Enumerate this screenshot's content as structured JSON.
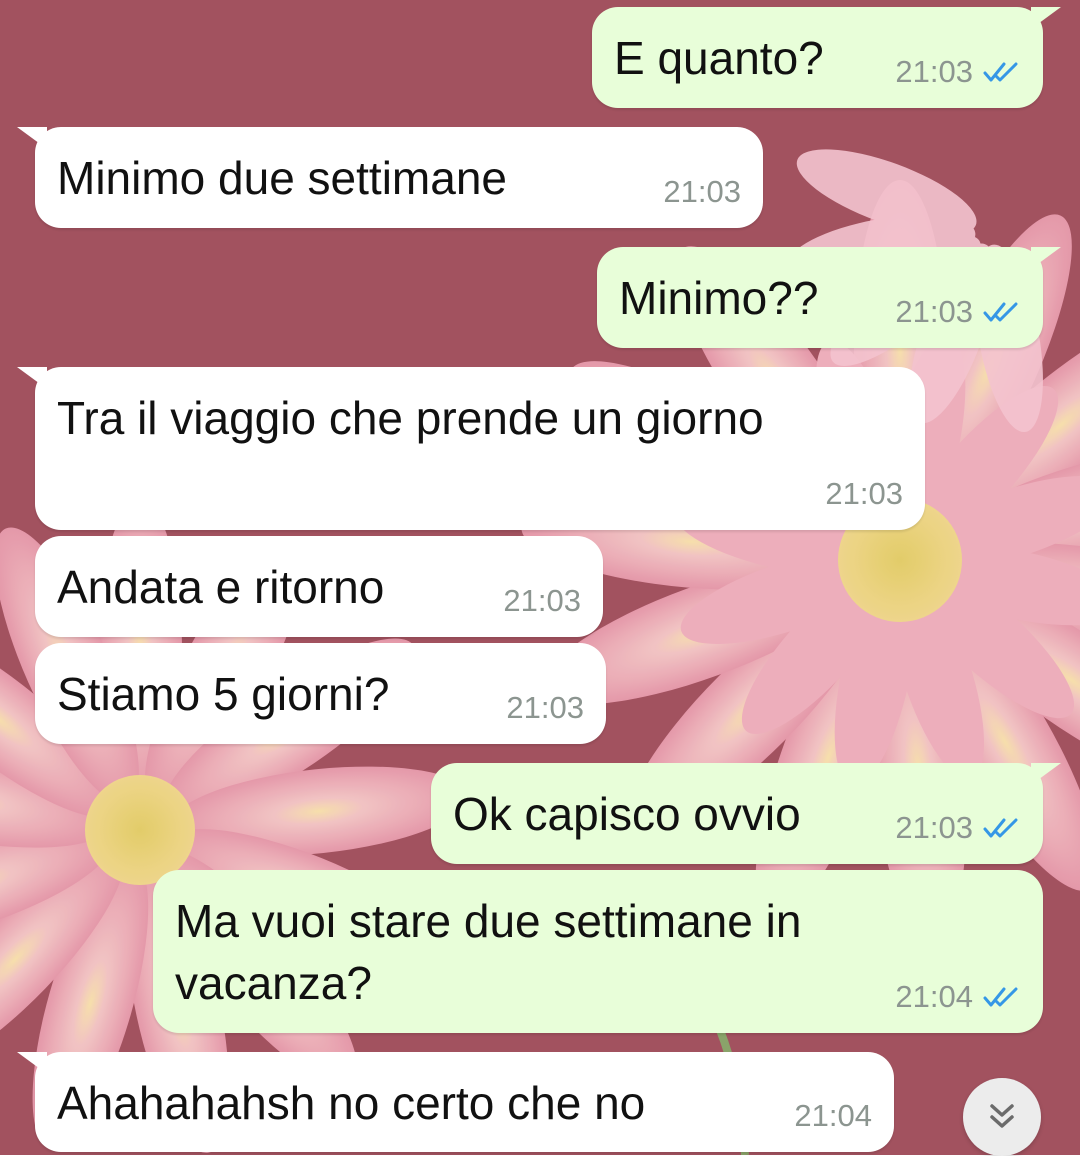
{
  "colors": {
    "wallpaper": "#a2525f",
    "incoming_bubble": "#ffffff",
    "outgoing_bubble": "#e8fed9",
    "read_ticks": "#3597e6",
    "timestamp": "#8c9590"
  },
  "messages": [
    {
      "direction": "outgoing",
      "text": "E quanto?",
      "time": "21:03",
      "status_icon": "double-check-read-icon"
    },
    {
      "direction": "incoming",
      "text": "Minimo due settimane",
      "time": "21:03"
    },
    {
      "direction": "outgoing",
      "text": "Minimo??",
      "time": "21:03",
      "status_icon": "double-check-read-icon"
    },
    {
      "direction": "incoming",
      "text": "Tra il viaggio che prende un giorno",
      "time": "21:03"
    },
    {
      "direction": "incoming",
      "text": "Andata e ritorno",
      "time": "21:03"
    },
    {
      "direction": "incoming",
      "text": "Stiamo 5 giorni?",
      "time": "21:03"
    },
    {
      "direction": "outgoing",
      "text": "Ok capisco ovvio",
      "time": "21:03",
      "status_icon": "double-check-read-icon"
    },
    {
      "direction": "outgoing",
      "text": "Ma vuoi stare due settimane in\nvacanza?",
      "time": "21:04",
      "status_icon": "double-check-read-icon"
    },
    {
      "direction": "incoming",
      "text": "Ahahahahsh no certo che no",
      "time": "21:04"
    }
  ],
  "scroll_to_bottom": {
    "icon": "chevron-double-down-icon"
  }
}
